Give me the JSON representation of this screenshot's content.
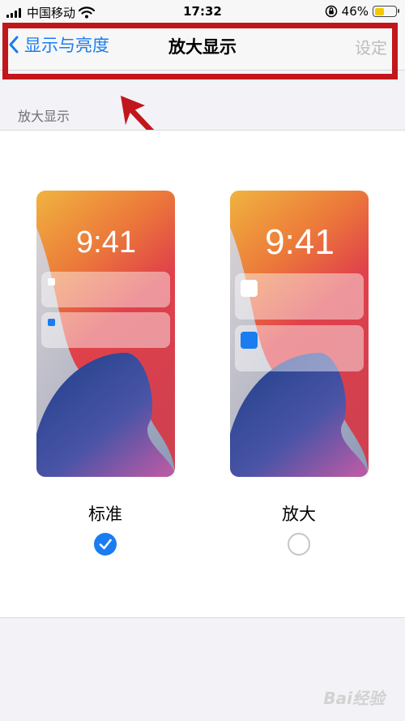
{
  "status_bar": {
    "carrier": "中国移动",
    "time": "17:32",
    "battery_percent": "46%",
    "battery_level": 0.46,
    "icons": [
      "signal-icon",
      "wifi-icon",
      "orientation-lock-icon",
      "battery-icon"
    ]
  },
  "nav": {
    "back_label": "显示与亮度",
    "title": "放大显示",
    "action_label": "设定"
  },
  "section_header": "放大显示",
  "options": [
    {
      "label": "标准",
      "preview_time": "9:41",
      "selected": true
    },
    {
      "label": "放大",
      "preview_time": "9:41",
      "selected": false
    }
  ],
  "colors": {
    "accent": "#1a7cf0",
    "annotation": "#c1161c",
    "disabled_text": "#bcbcbc"
  },
  "watermark": "Bai经验"
}
